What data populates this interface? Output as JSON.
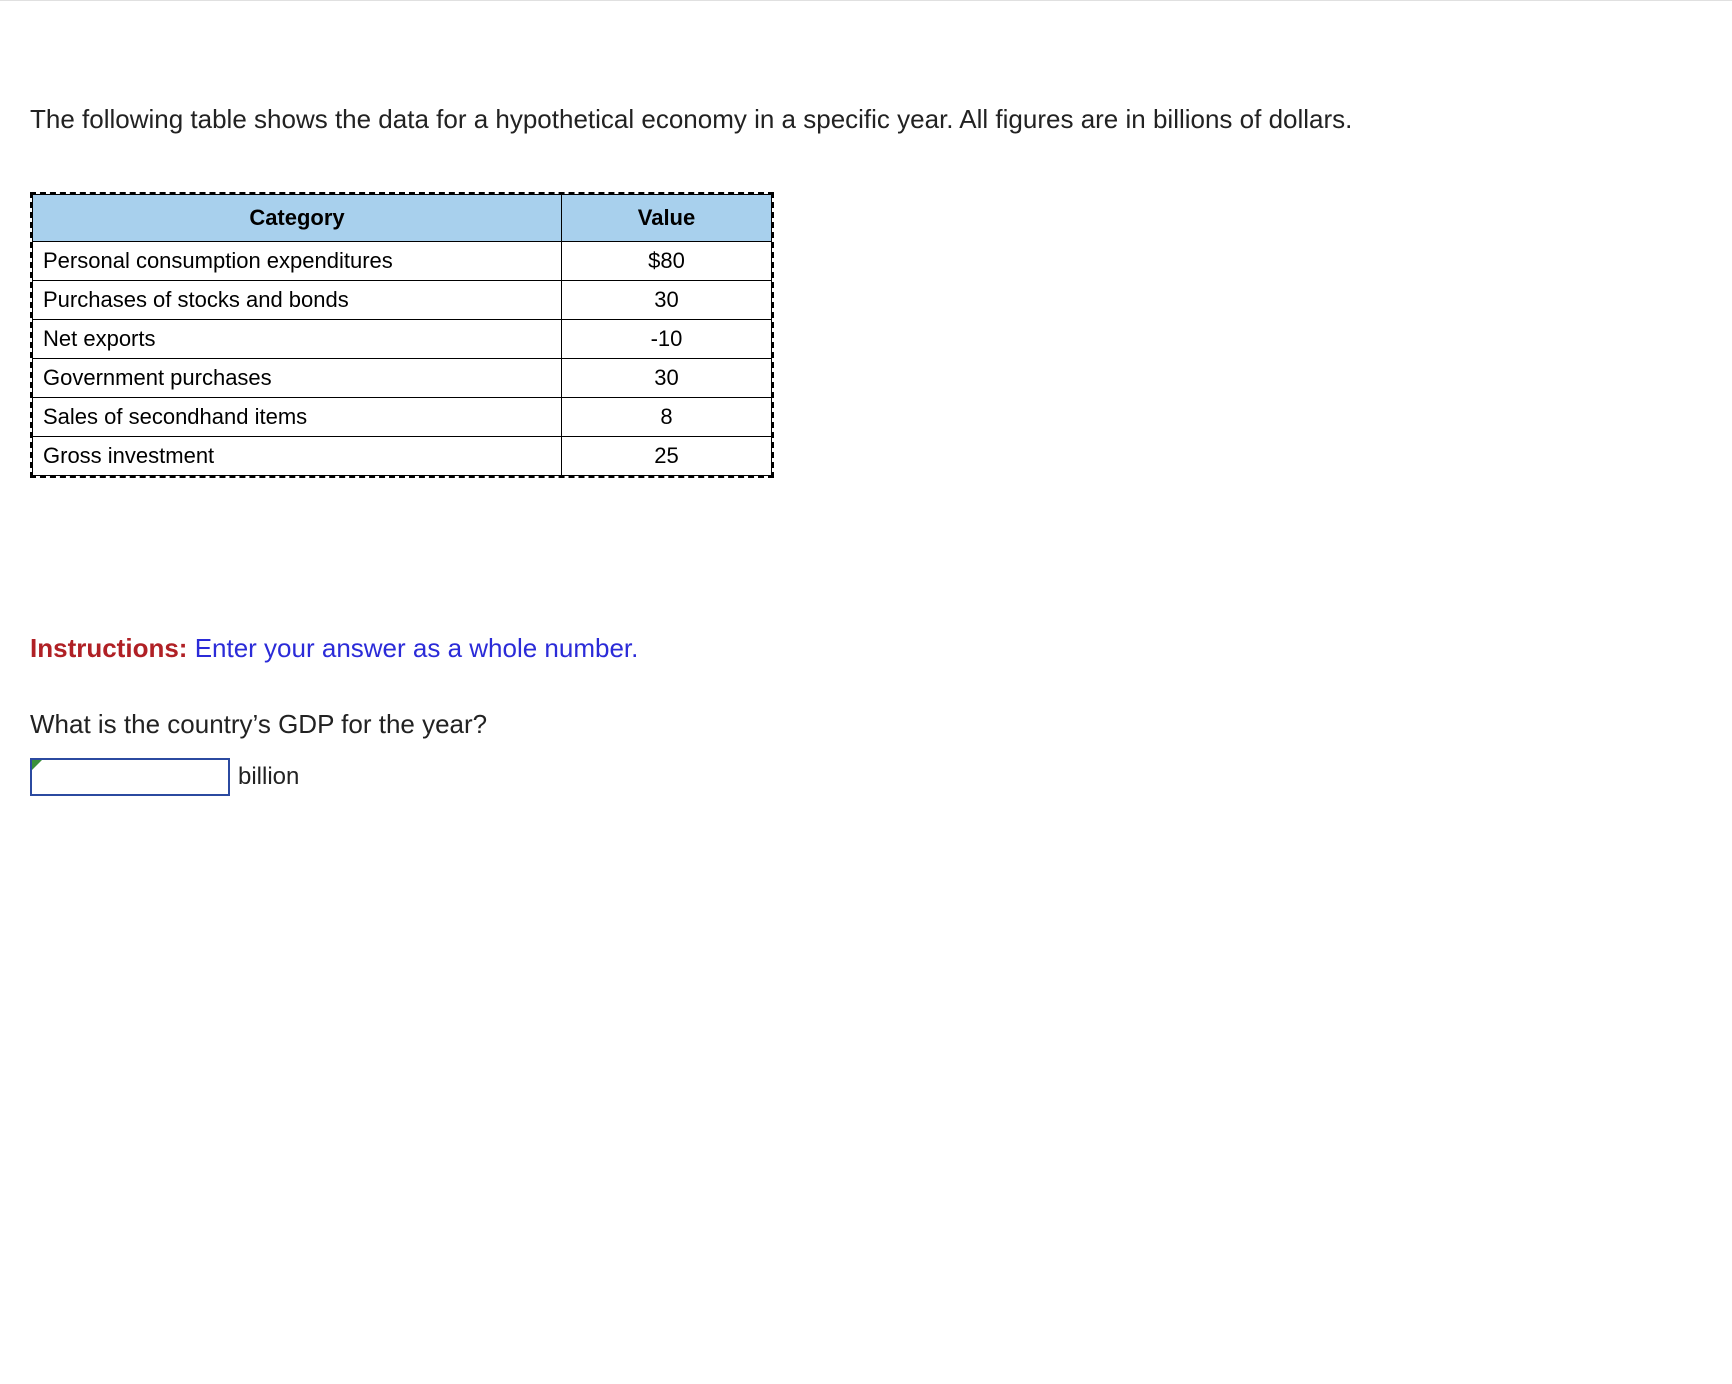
{
  "intro": "The following table shows the data for a hypothetical economy in a specific year. All figures are in billions of dollars.",
  "table": {
    "headers": {
      "category": "Category",
      "value": "Value"
    },
    "rows": [
      {
        "category": "Personal consumption expenditures",
        "value": "$80"
      },
      {
        "category": "Purchases of stocks and bonds",
        "value": "30"
      },
      {
        "category": "Net exports",
        "value": "-10"
      },
      {
        "category": "Government purchases",
        "value": "30"
      },
      {
        "category": "Sales of secondhand items",
        "value": "8"
      },
      {
        "category": "Gross investment",
        "value": "25"
      }
    ]
  },
  "instructions": {
    "label": "Instructions:",
    "text": "Enter your answer as a whole number."
  },
  "question": "What is the country’s GDP for the year?",
  "answer": {
    "value": "",
    "unit": "billion"
  }
}
